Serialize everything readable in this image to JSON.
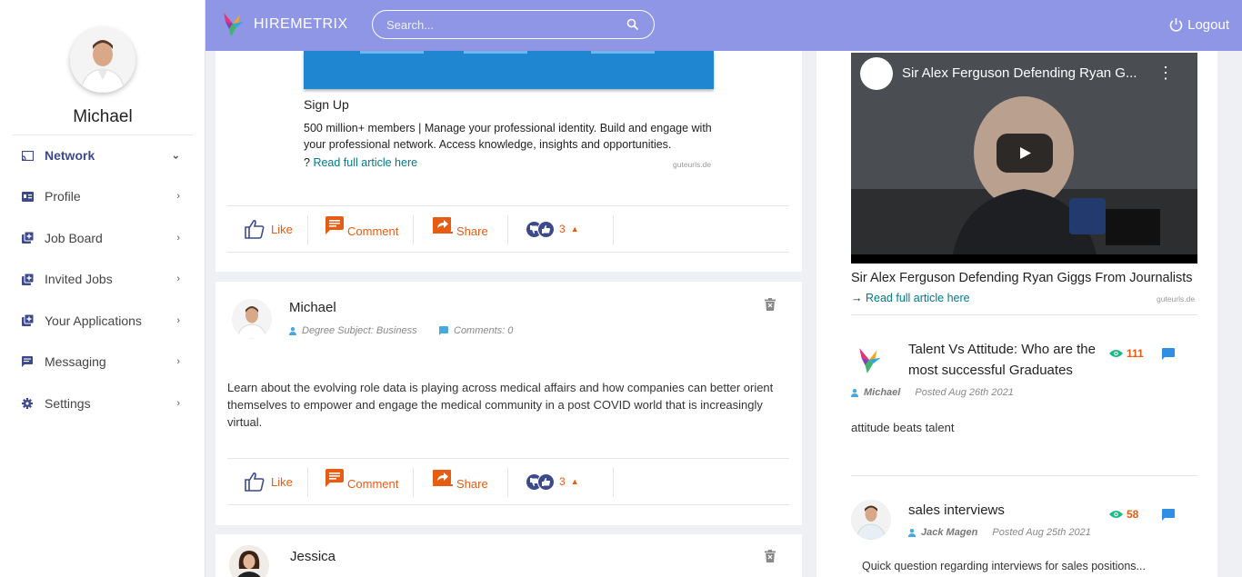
{
  "user": {
    "name": "Michael"
  },
  "sidebar": {
    "items": [
      {
        "label": "Network"
      },
      {
        "label": "Profile"
      },
      {
        "label": "Job Board"
      },
      {
        "label": "Invited Jobs"
      },
      {
        "label": "Your Applications"
      },
      {
        "label": "Messaging"
      },
      {
        "label": "Settings"
      }
    ]
  },
  "header": {
    "brand": "HIREMETRIX",
    "search_placeholder": "Search...",
    "logout_label": "Logout",
    "bg_color": "#8f96e6"
  },
  "posts": [
    {
      "link_title": "Sign Up",
      "link_desc": "500 million+ members | Manage your professional identity. Build and engage with your professional network. Access knowledge, insights and opportunities.",
      "read_prefix": "?",
      "read_label": "Read full article here",
      "source": "guteurls.de",
      "like": "Like",
      "comment": "Comment",
      "share": "Share",
      "reactions": "3"
    },
    {
      "author": "Michael",
      "degree": "Degree Subject: Business",
      "comments": "Comments: 0",
      "body": "Learn about the evolving role data is playing across medical affairs and how companies can better orient themselves to empower and engage the medical community in a post COVID world that is increasingly virtual.",
      "like": "Like",
      "comment": "Comment",
      "share": "Share",
      "reactions": "3"
    },
    {
      "author": "Jessica"
    }
  ],
  "right": {
    "video_title": "Sir Alex Ferguson Defending Ryan G...",
    "video_caption": "Sir Alex Ferguson Defending Ryan Giggs From Journalists",
    "read_prefix": "→",
    "read_label": "Read full article here",
    "source": "guteurls.de",
    "blogs": [
      {
        "title": "Talent Vs Attitude: Who are the most successful Graduates",
        "views": "111",
        "author": "Michael",
        "date": "Posted Aug 26th 2021",
        "text": "attitude beats talent"
      },
      {
        "title": "sales interviews",
        "views": "58",
        "author": "Jack Magen",
        "date": "Posted Aug 25th 2021",
        "text": "Quick question regarding interviews for sales positions..."
      }
    ]
  },
  "colors": {
    "accent": "#e65c12",
    "nav_active": "#3c4a8c",
    "link": "#007a8a"
  }
}
